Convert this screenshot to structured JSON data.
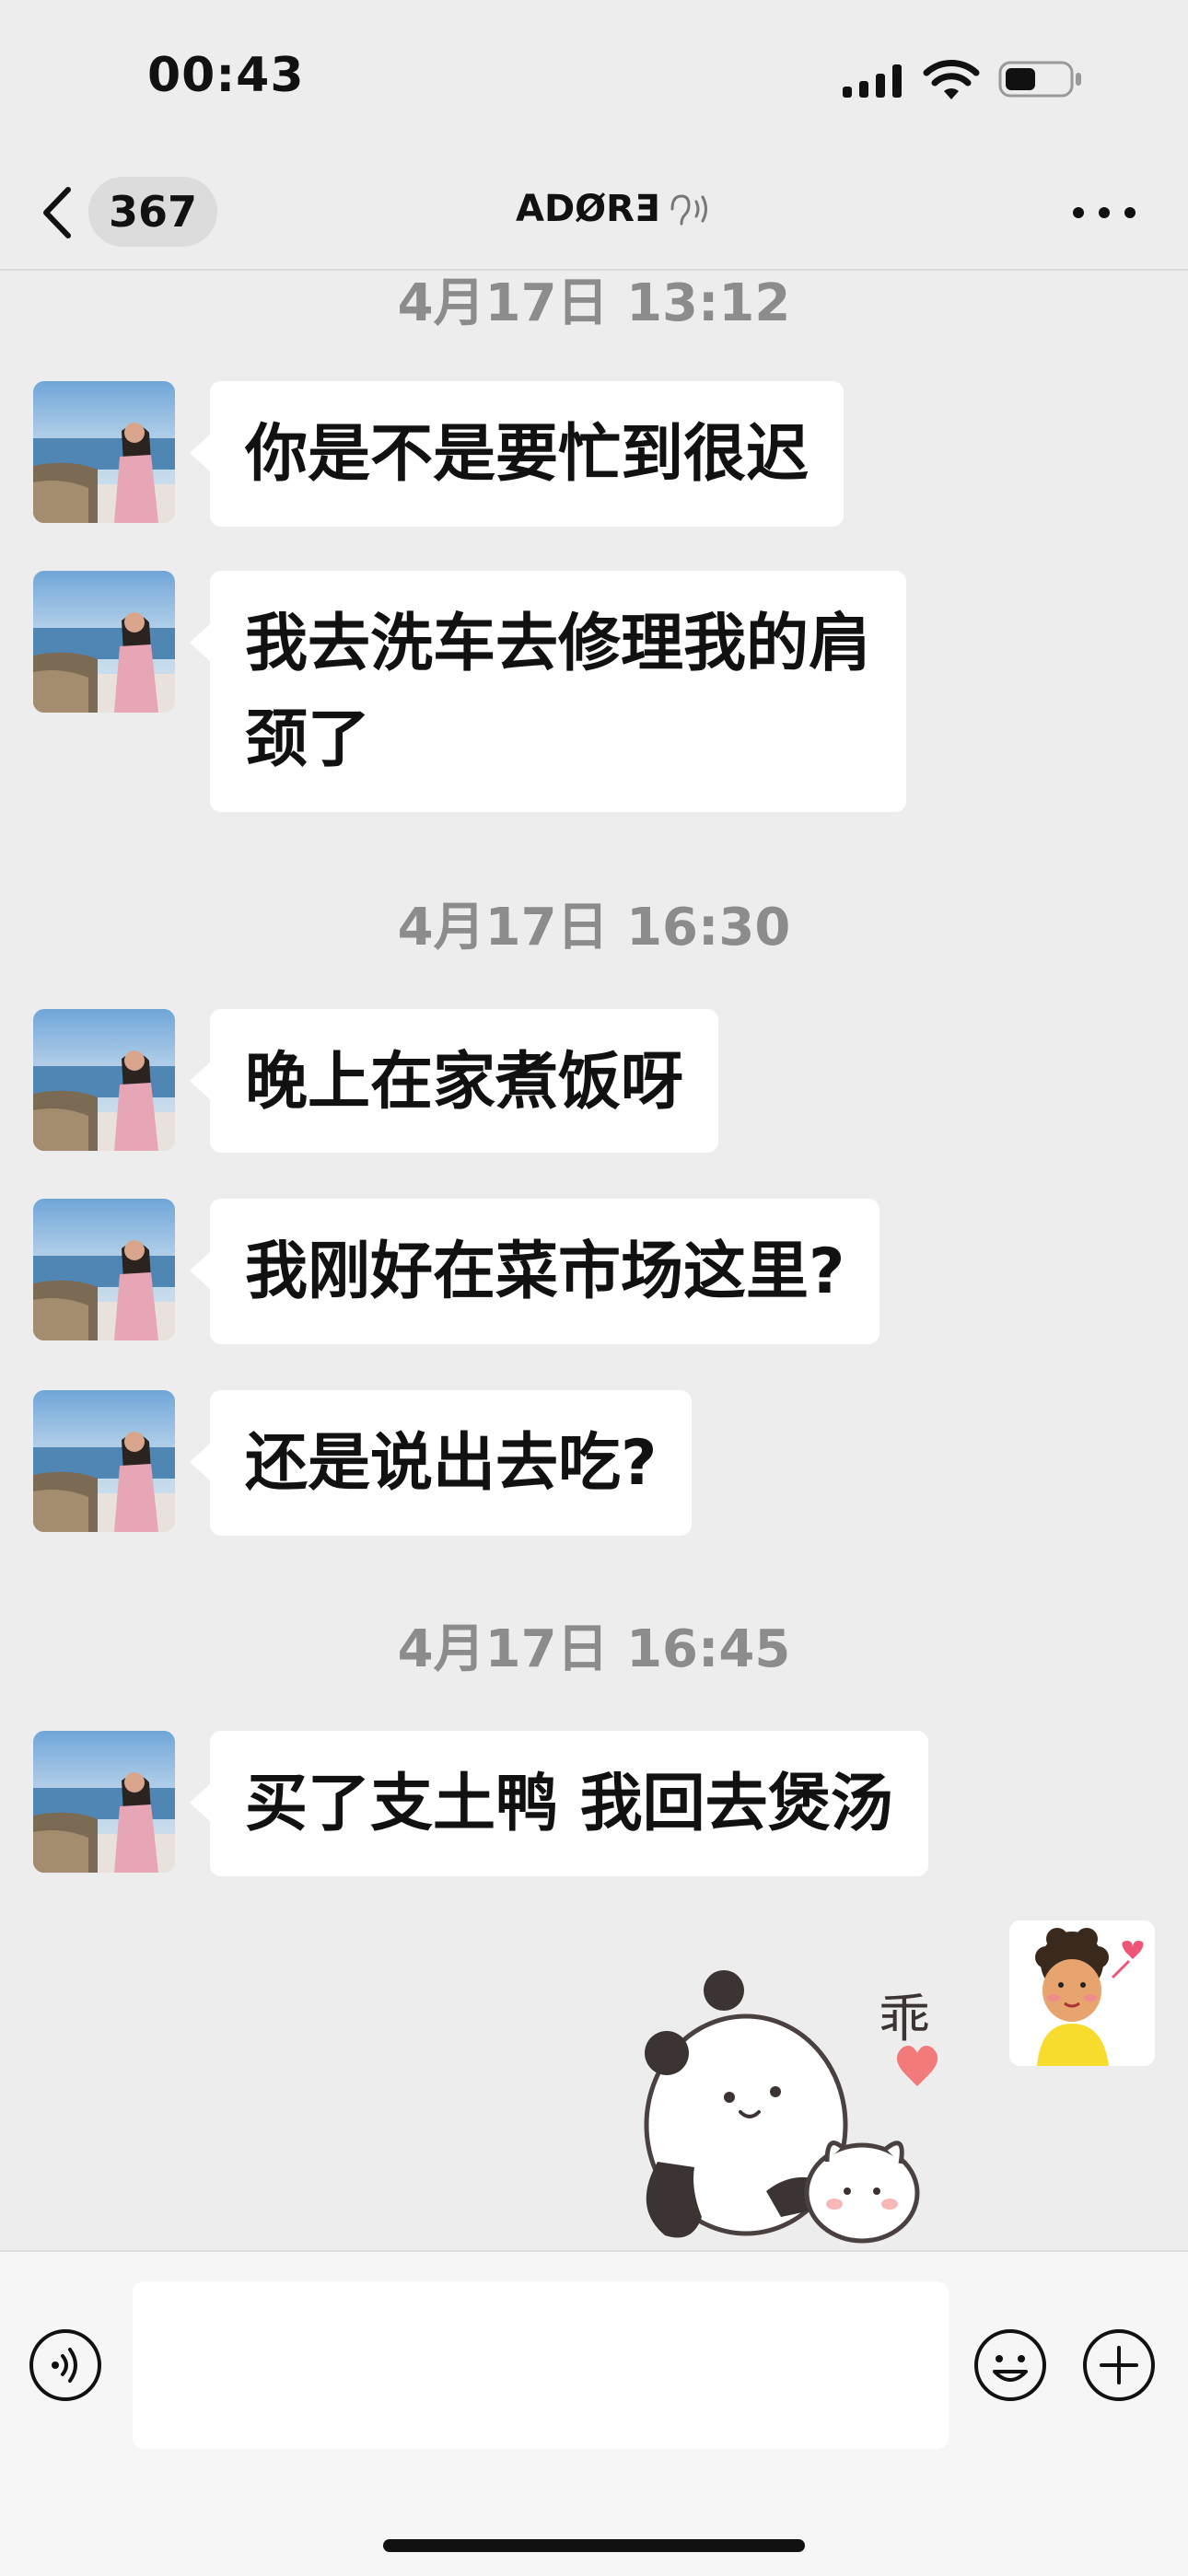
{
  "status": {
    "time": "00:43"
  },
  "nav": {
    "unread_count": "367",
    "title": "ADØRƎ"
  },
  "messages": [
    {
      "type": "timestamp",
      "text": "4月17日 13:12"
    },
    {
      "type": "text",
      "sender": "contact",
      "text": "你是不是要忙到很迟"
    },
    {
      "type": "text",
      "sender": "contact",
      "text": "我去洗车去修理我的肩\n颈了"
    },
    {
      "type": "timestamp",
      "text": "4月17日 16:30"
    },
    {
      "type": "text",
      "sender": "contact",
      "text": "晚上在家煮饭呀"
    },
    {
      "type": "text",
      "sender": "contact",
      "text": "我刚好在菜市场这里?"
    },
    {
      "type": "text",
      "sender": "contact",
      "text": "还是说出去吃?"
    },
    {
      "type": "timestamp",
      "text": "4月17日 16:45"
    },
    {
      "type": "text",
      "sender": "contact",
      "text": "买了支土鸭 我回去煲汤"
    },
    {
      "type": "sticker",
      "sender": "self",
      "text": "乖",
      "icon": "panda-sticker"
    }
  ],
  "input": {
    "value": "",
    "placeholder": ""
  },
  "icons": {
    "back": "chevron-left-icon",
    "more": "more-dots-icon",
    "voice": "voice-input-icon",
    "emoji": "emoji-icon",
    "plus": "plus-icon",
    "signal": "signal-icon",
    "wifi": "wifi-icon",
    "battery": "battery-icon",
    "sound": "sound-icon"
  }
}
